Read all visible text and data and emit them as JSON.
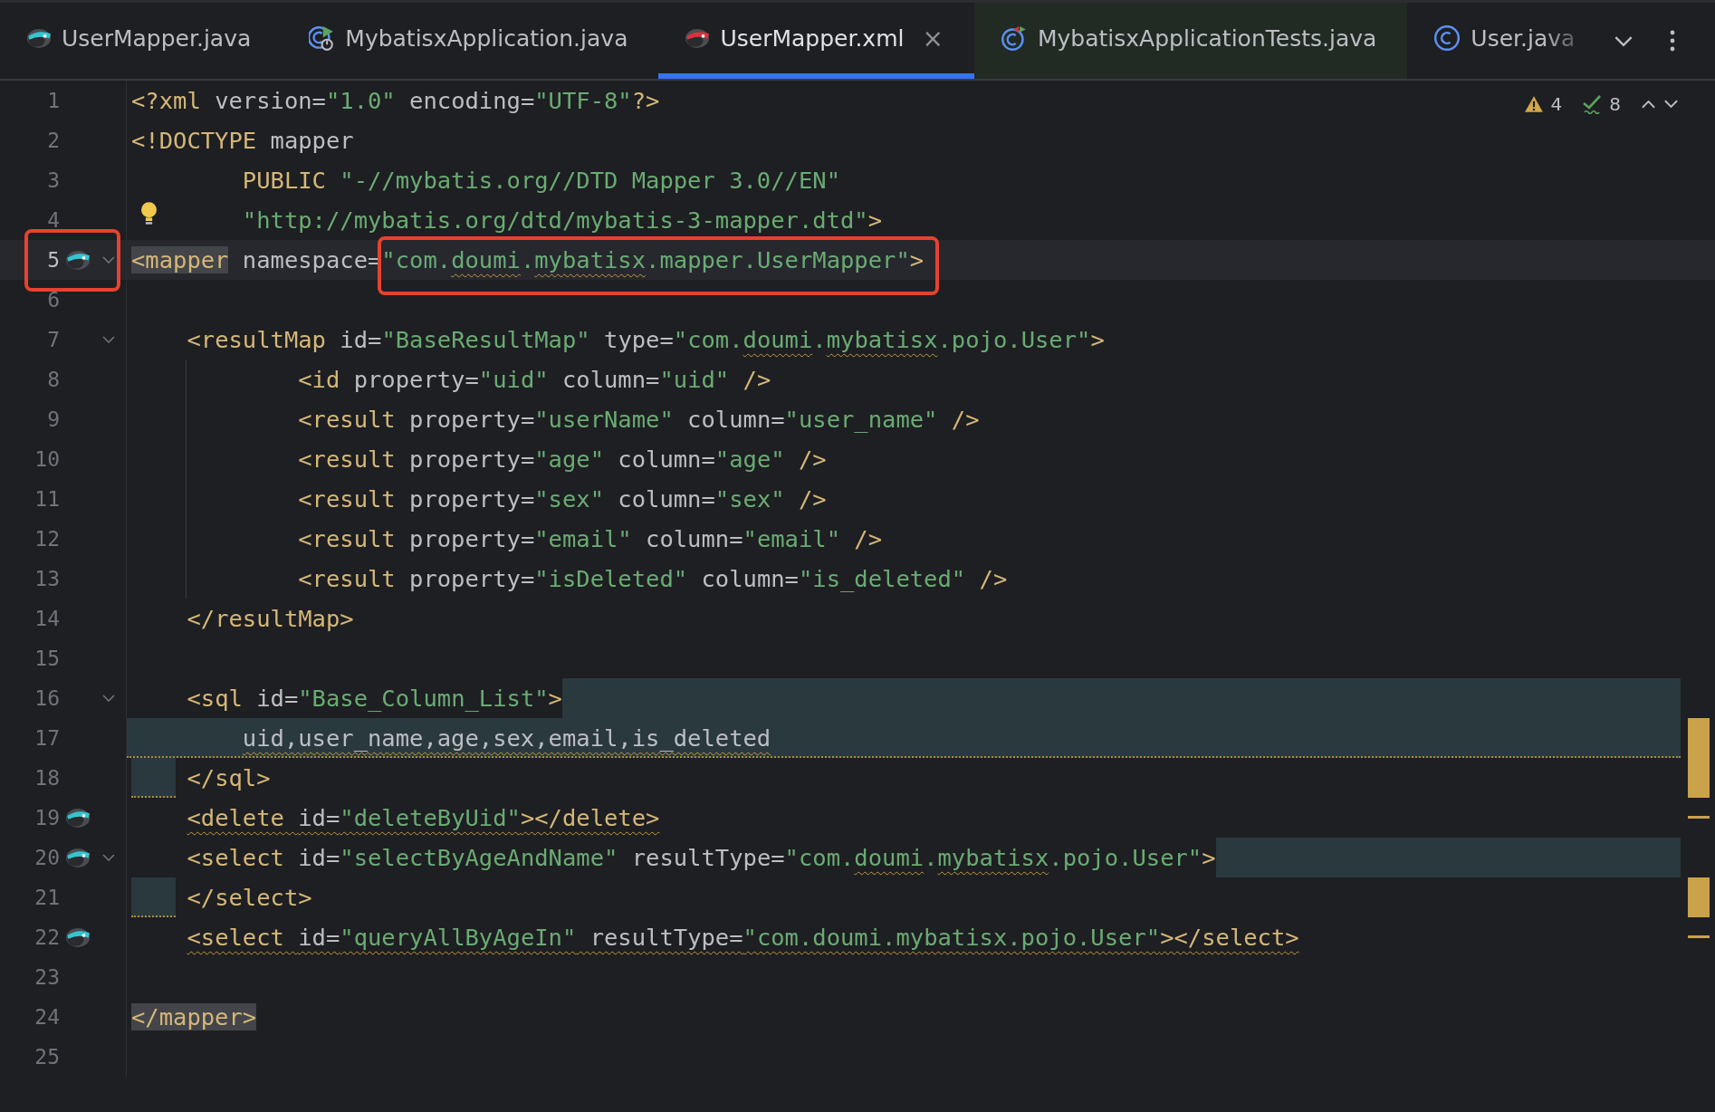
{
  "tabs": [
    {
      "label": "UserMapper.java",
      "selected": false,
      "tinted": false,
      "faded": false
    },
    {
      "label": "MybatisxApplication.java",
      "selected": false,
      "tinted": false,
      "faded": false
    },
    {
      "label": "UserMapper.xml",
      "selected": true,
      "tinted": false,
      "close": "×",
      "faded": false
    },
    {
      "label": "MybatisxApplicationTests.java",
      "selected": false,
      "tinted": true,
      "faded": false
    },
    {
      "label": "User.java",
      "selected": false,
      "tinted": false,
      "faded": true
    }
  ],
  "inspections": {
    "warnings": "4",
    "checks": "8"
  },
  "lines": [
    {
      "number": "1",
      "tokens": [
        {
          "kind": "tag",
          "text": "<?xml "
        },
        {
          "kind": "plain",
          "text": "version="
        },
        {
          "kind": "value",
          "text": "\"1.0\""
        },
        {
          "kind": "plain",
          "text": " encoding="
        },
        {
          "kind": "value",
          "text": "\"UTF-8\""
        },
        {
          "kind": "tag",
          "text": "?>"
        }
      ]
    },
    {
      "number": "2",
      "tokens": [
        {
          "kind": "tag",
          "text": "<!DOCTYPE "
        },
        {
          "kind": "plain",
          "text": "mapper"
        }
      ]
    },
    {
      "number": "3",
      "tokens": [
        {
          "kind": "tag",
          "text": "        PUBLIC "
        },
        {
          "kind": "value",
          "text": "\"-//mybatis.org//DTD Mapper 3.0//EN\""
        }
      ]
    },
    {
      "number": "4",
      "bulb": true,
      "tokens": [
        {
          "kind": "value",
          "text": "        \"http://mybatis.org/dtd/mybatis-3-mapper.dtd\""
        },
        {
          "kind": "tag",
          "text": ">"
        }
      ]
    },
    {
      "number": "5",
      "current": true,
      "mapped": true,
      "fold": true,
      "gutter_box": true,
      "tokens": [
        {
          "kind": "tag",
          "text": "<mapper",
          "match": true
        },
        {
          "kind": "plain",
          "text": " namespace="
        },
        {
          "kind": "value",
          "boxed": true,
          "parts": [
            {
              "text": "\"com."
            },
            {
              "text": "doumi",
              "warn": true
            },
            {
              "text": "."
            },
            {
              "text": "mybatisx",
              "warn": true
            },
            {
              "text": ".mapper.UserMapper\""
            }
          ]
        },
        {
          "kind": "tag",
          "text": ">"
        }
      ]
    },
    {
      "number": "6"
    },
    {
      "number": "7",
      "fold": true,
      "tokens": [
        {
          "kind": "tag",
          "text": "    <resultMap "
        },
        {
          "kind": "plain",
          "text": "id="
        },
        {
          "kind": "value",
          "text": "\"BaseResultMap\""
        },
        {
          "kind": "plain",
          "text": " type="
        },
        {
          "kind": "value",
          "text": "\"com."
        },
        {
          "kind": "value",
          "text": "doumi",
          "warn": true
        },
        {
          "kind": "value",
          "text": "."
        },
        {
          "kind": "value",
          "text": "mybatisx",
          "warn": true
        },
        {
          "kind": "value",
          "text": ".pojo.User\""
        },
        {
          "kind": "tag",
          "text": ">"
        }
      ]
    },
    {
      "number": "8",
      "guide": true,
      "tokens": [
        {
          "kind": "tag",
          "text": "            <id "
        },
        {
          "kind": "plain",
          "text": "property="
        },
        {
          "kind": "value",
          "text": "\"uid\""
        },
        {
          "kind": "plain",
          "text": " column="
        },
        {
          "kind": "value",
          "text": "\"uid\""
        },
        {
          "kind": "tag",
          "text": " />"
        }
      ]
    },
    {
      "number": "9",
      "guide": true,
      "tokens": [
        {
          "kind": "tag",
          "text": "            <result "
        },
        {
          "kind": "plain",
          "text": "property="
        },
        {
          "kind": "value",
          "text": "\"userName\""
        },
        {
          "kind": "plain",
          "text": " column="
        },
        {
          "kind": "value",
          "text": "\"user_name\""
        },
        {
          "kind": "tag",
          "text": " />"
        }
      ]
    },
    {
      "number": "10",
      "guide": true,
      "tokens": [
        {
          "kind": "tag",
          "text": "            <result "
        },
        {
          "kind": "plain",
          "text": "property="
        },
        {
          "kind": "value",
          "text": "\"age\""
        },
        {
          "kind": "plain",
          "text": " column="
        },
        {
          "kind": "value",
          "text": "\"age\""
        },
        {
          "kind": "tag",
          "text": " />"
        }
      ]
    },
    {
      "number": "11",
      "guide": true,
      "tokens": [
        {
          "kind": "tag",
          "text": "            <result "
        },
        {
          "kind": "plain",
          "text": "property="
        },
        {
          "kind": "value",
          "text": "\"sex\""
        },
        {
          "kind": "plain",
          "text": " column="
        },
        {
          "kind": "value",
          "text": "\"sex\""
        },
        {
          "kind": "tag",
          "text": " />"
        }
      ]
    },
    {
      "number": "12",
      "guide": true,
      "tokens": [
        {
          "kind": "tag",
          "text": "            <result "
        },
        {
          "kind": "plain",
          "text": "property="
        },
        {
          "kind": "value",
          "text": "\"email\""
        },
        {
          "kind": "plain",
          "text": " column="
        },
        {
          "kind": "value",
          "text": "\"email\""
        },
        {
          "kind": "tag",
          "text": " />"
        }
      ]
    },
    {
      "number": "13",
      "guide": true,
      "tokens": [
        {
          "kind": "tag",
          "text": "            <result "
        },
        {
          "kind": "plain",
          "text": "property="
        },
        {
          "kind": "value",
          "text": "\"isDeleted\""
        },
        {
          "kind": "plain",
          "text": " column="
        },
        {
          "kind": "value",
          "text": "\"is_deleted\""
        },
        {
          "kind": "tag",
          "text": " />"
        }
      ]
    },
    {
      "number": "14",
      "tokens": [
        {
          "kind": "tag",
          "text": "    </resultMap>"
        }
      ]
    },
    {
      "number": "15"
    },
    {
      "number": "16",
      "fold": true,
      "band_tail": true,
      "tokens": [
        {
          "kind": "tag",
          "text": "    <sql "
        },
        {
          "kind": "plain",
          "text": "id="
        },
        {
          "kind": "value",
          "text": "\"Base_Column_List\""
        },
        {
          "kind": "tag",
          "text": ">"
        }
      ]
    },
    {
      "number": "17",
      "band_full": true,
      "stripe_block": true,
      "tokens": [
        {
          "kind": "plain",
          "text": "        uid,user_name,age,sex,email,is_deleted",
          "warn": true
        }
      ]
    },
    {
      "number": "18",
      "band_lead": true,
      "stripe_block": true,
      "tokens": [
        {
          "kind": "tag",
          "text": "    </sql>"
        }
      ]
    },
    {
      "number": "19",
      "mapped": true,
      "stripe_tick": true,
      "tokens": [
        {
          "kind": "tag",
          "text": "    <delete ",
          "warn": true
        },
        {
          "kind": "plain",
          "text": "id=",
          "warn": true
        },
        {
          "kind": "value",
          "text": "\"deleteByUid\"",
          "warn": true
        },
        {
          "kind": "tag",
          "text": "></delete>",
          "warn": true
        }
      ]
    },
    {
      "number": "20",
      "mapped": true,
      "fold": true,
      "band_tail": true,
      "tokens": [
        {
          "kind": "tag",
          "text": "    <select "
        },
        {
          "kind": "plain",
          "text": "id="
        },
        {
          "kind": "value",
          "text": "\"selectByAgeAndName\""
        },
        {
          "kind": "plain",
          "text": " resultType="
        },
        {
          "kind": "value",
          "text": "\"com."
        },
        {
          "kind": "value",
          "text": "doumi",
          "warn": true
        },
        {
          "kind": "value",
          "text": "."
        },
        {
          "kind": "value",
          "text": "mybatisx",
          "warn": true
        },
        {
          "kind": "value",
          "text": ".pojo.User\""
        },
        {
          "kind": "tag",
          "text": ">"
        }
      ]
    },
    {
      "number": "21",
      "band_lead": true,
      "stripe_block": true,
      "tokens": [
        {
          "kind": "tag",
          "text": "    </select>"
        }
      ]
    },
    {
      "number": "22",
      "mapped": true,
      "stripe_tick": true,
      "tokens": [
        {
          "kind": "tag",
          "text": "    <select ",
          "warn": true
        },
        {
          "kind": "plain",
          "text": "id=",
          "warn": true
        },
        {
          "kind": "value",
          "text": "\"queryAllByAgeIn\"",
          "warn": true
        },
        {
          "kind": "plain",
          "text": " resultType=",
          "warn": true
        },
        {
          "kind": "value",
          "text": "\"com.doumi.mybatisx.pojo.User\"",
          "warn": true
        },
        {
          "kind": "tag",
          "text": "></select>",
          "warn": true
        }
      ]
    },
    {
      "number": "23"
    },
    {
      "number": "24",
      "tokens": [
        {
          "kind": "tag",
          "text": "</mapper>",
          "match": true
        }
      ]
    },
    {
      "number": "25"
    }
  ]
}
